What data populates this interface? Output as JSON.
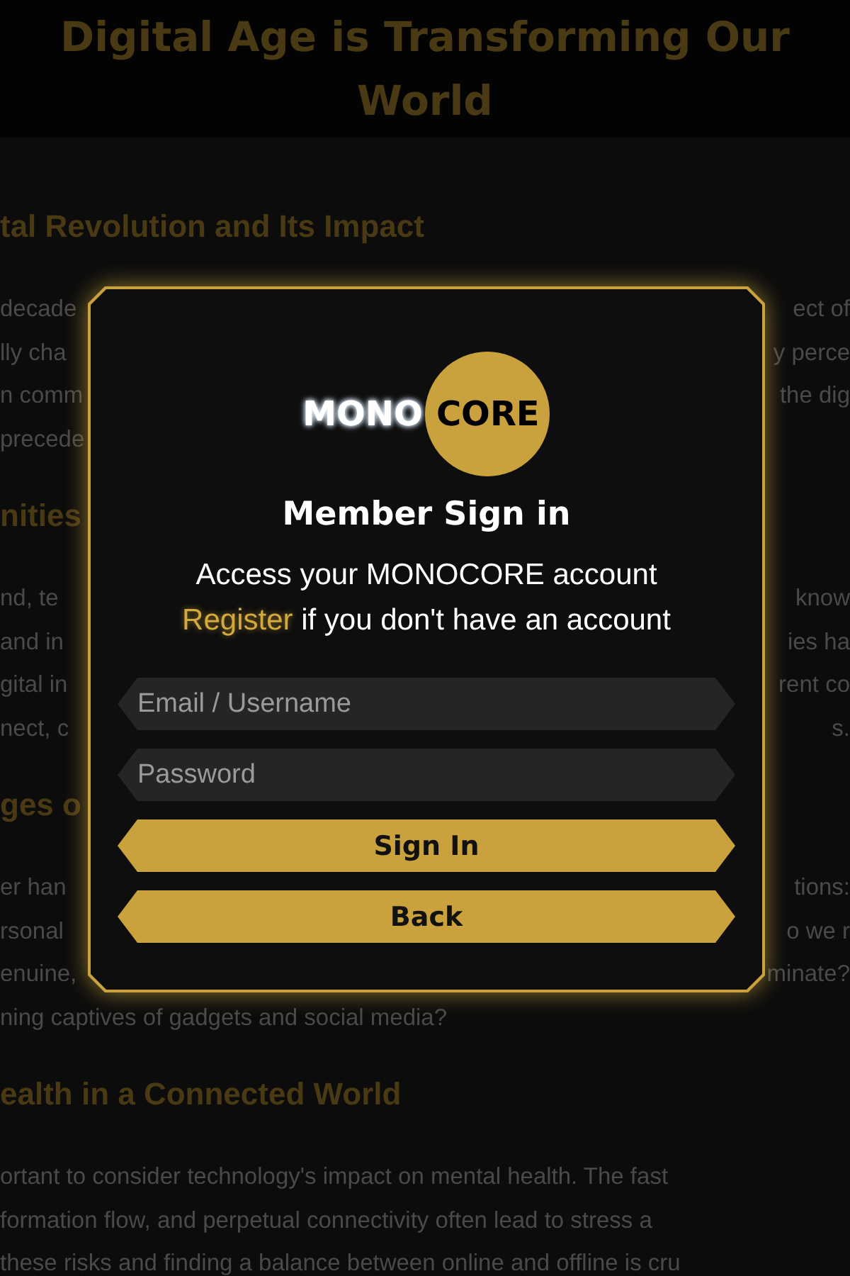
{
  "background_page": {
    "header_title": "Digital Age is Transforming Our World",
    "sections": [
      {
        "heading": "tal Revolution and Its Impact",
        "lines": [
          {
            "left": "decade",
            "right": "ect  of"
          },
          {
            "left": "lly cha",
            "right": "y perce"
          },
          {
            "left": "n comm",
            "right": "the dig"
          },
          {
            "left": "precede"
          }
        ]
      },
      {
        "heading": "nities",
        "lines": [
          {
            "left": "nd,  te",
            "right": "know"
          },
          {
            "left": "and  in",
            "right": "ies  ha"
          },
          {
            "left": "gital in",
            "right": "rent co"
          },
          {
            "left": "nect, c",
            "right": "s."
          }
        ]
      },
      {
        "heading": "ges o",
        "lines": [
          {
            "left": "er  han",
            "right": "tions:"
          },
          {
            "left": "rsonal",
            "right": "o  we  r"
          },
          {
            "left": "enuine,",
            "right": "minate?"
          },
          {
            "left": "ning captives of gadgets and social media?"
          }
        ]
      },
      {
        "heading": "ealth in a Connected World",
        "lines": [
          {
            "left": "ortant to consider technology's impact on mental health. The fast"
          },
          {
            "left": "formation flow, and perpetual connectivity often lead to stress a"
          },
          {
            "left": "these risks and finding a balance between online and offline is cru"
          }
        ]
      }
    ]
  },
  "modal": {
    "logo": {
      "left": "MONO",
      "right": "CORE"
    },
    "title": "Member Sign in",
    "subtitle": "Access your MONOCORE account",
    "register_link": "Register",
    "register_text": "if you don't have an account",
    "fields": [
      {
        "placeholder": "Email / Username"
      },
      {
        "placeholder": "Password"
      }
    ],
    "buttons": [
      "Sign In",
      "Back"
    ]
  }
}
